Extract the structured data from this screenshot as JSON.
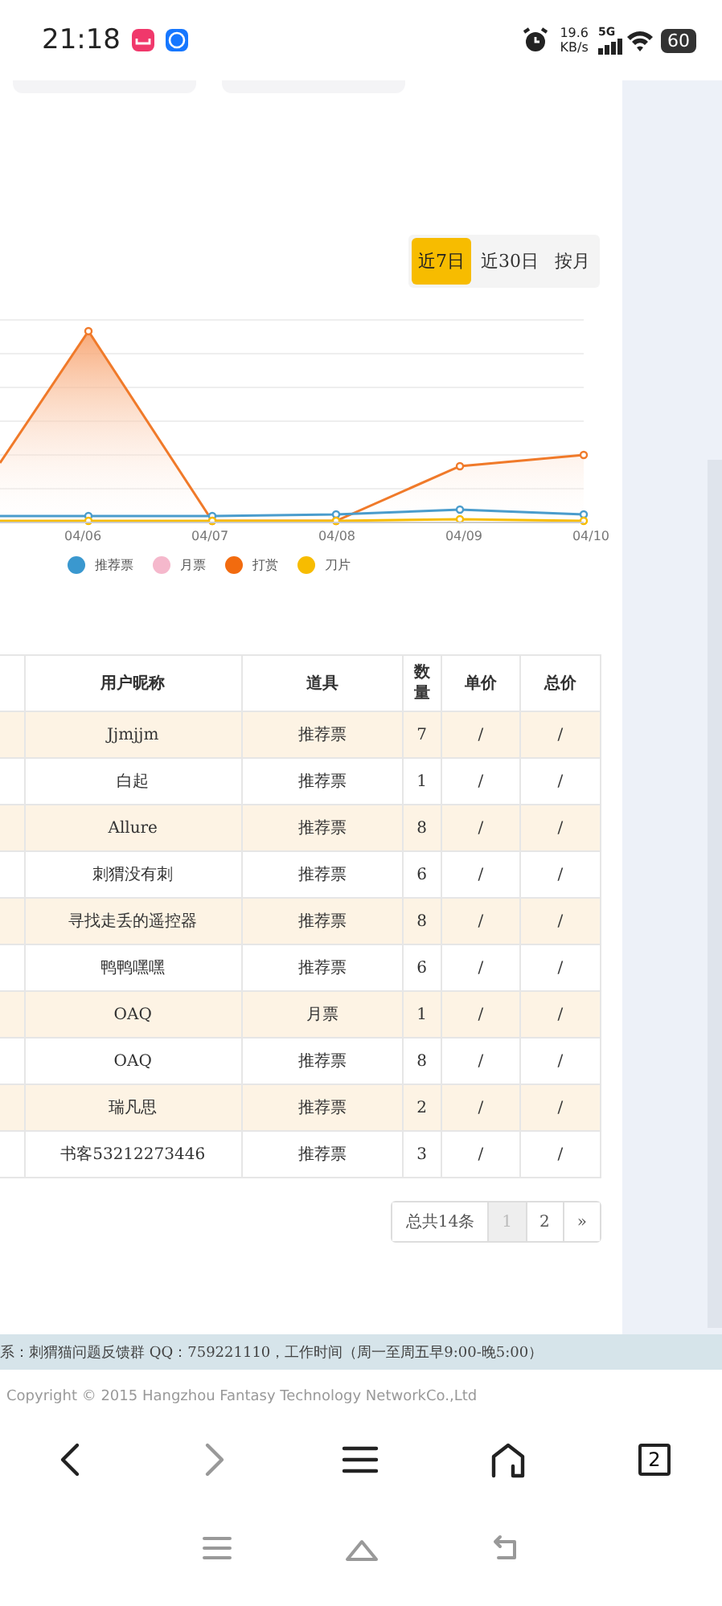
{
  "status_bar": {
    "time": "21:18",
    "net_speed": "19.6",
    "net_unit": "KB/s",
    "network": "5G",
    "battery": "60"
  },
  "range_tabs": [
    {
      "label": "近7日",
      "selected": true
    },
    {
      "label": "近30日",
      "selected": false
    },
    {
      "label": "按月",
      "selected": false
    }
  ],
  "chart": {
    "x_labels": [
      "04/06",
      "04/07",
      "04/08",
      "04/09",
      "04/10"
    ],
    "legend": [
      {
        "label": "推荐票",
        "color": "#3a98cf"
      },
      {
        "label": "月票",
        "color": "#f5b8cc"
      },
      {
        "label": "打赏",
        "color": "#f26b0f"
      },
      {
        "label": "刀片",
        "color": "#f7bc00"
      }
    ]
  },
  "table": {
    "columns": [
      "用户昵称",
      "道具",
      "数量",
      "单价",
      "总价"
    ],
    "rows": [
      [
        "Jjmjjm",
        "推荐票",
        "7",
        "/",
        "/"
      ],
      [
        "白起",
        "推荐票",
        "1",
        "/",
        "/"
      ],
      [
        "Allure",
        "推荐票",
        "8",
        "/",
        "/"
      ],
      [
        "刺猬没有刺",
        "推荐票",
        "6",
        "/",
        "/"
      ],
      [
        "寻找走丢的遥控器",
        "推荐票",
        "8",
        "/",
        "/"
      ],
      [
        "鸭鸭嘿嘿",
        "推荐票",
        "6",
        "/",
        "/"
      ],
      [
        "OAQ",
        "月票",
        "1",
        "/",
        "/"
      ],
      [
        "OAQ",
        "推荐票",
        "8",
        "/",
        "/"
      ],
      [
        "瑞凡思",
        "推荐票",
        "2",
        "/",
        "/"
      ],
      [
        "书客53212273446",
        "推荐票",
        "3",
        "/",
        "/"
      ]
    ]
  },
  "pagination": {
    "total": "总共14条",
    "pages": [
      {
        "label": "1",
        "selected": true
      },
      {
        "label": "2",
        "selected": false
      }
    ],
    "next": "»"
  },
  "footer": {
    "contact": "系：刺猬猫问题反馈群 QQ：759221110，工作时间（周一至周五早9:00-晚5:00）",
    "copyright": "Copyright © 2015 Hangzhou Fantasy Technology NetworkCo.,Ltd"
  },
  "browser_bar": {
    "tab_count": "2"
  }
}
